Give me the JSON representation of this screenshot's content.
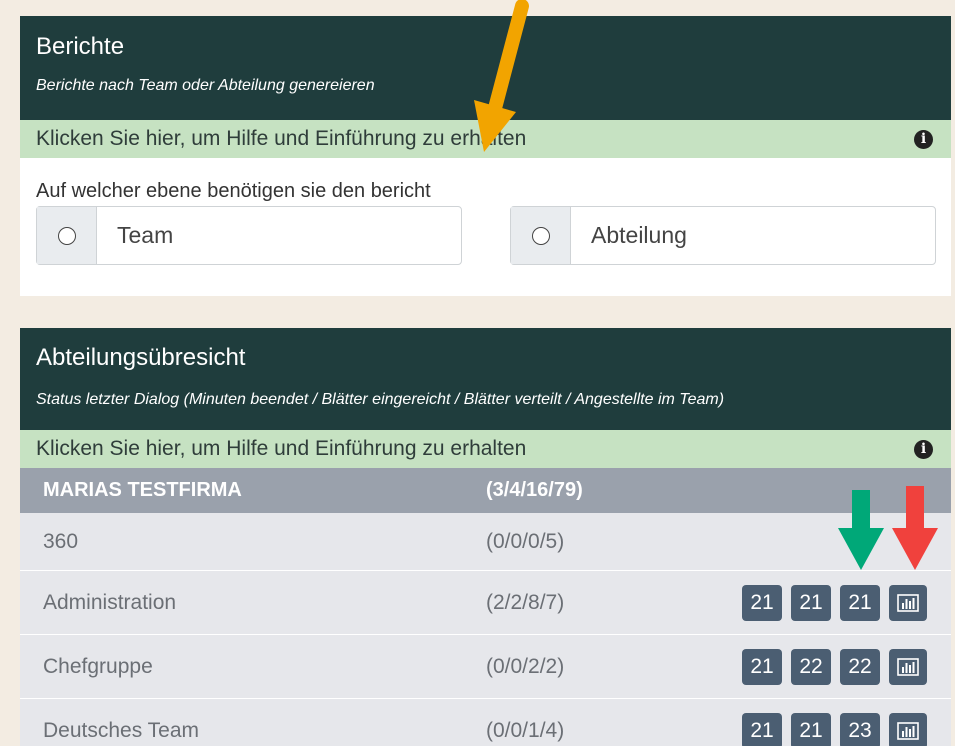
{
  "reports_panel": {
    "title": "Berichte",
    "subtitle": "Berichte nach Team oder Abteilung genereieren",
    "help_text": "Klicken Sie hier, um Hilfe und Einführung zu erhalten",
    "question": "Auf welcher ebene benötigen sie den bericht",
    "options": [
      {
        "label": "Team"
      },
      {
        "label": "Abteilung"
      }
    ]
  },
  "overview_panel": {
    "title": "Abteilungsübresicht",
    "subtitle": "Status letzter Dialog (Minuten beendet / Blätter eingereicht / Blätter verteilt / Angestellte im Team)",
    "help_text": "Klicken Sie hier, um Hilfe und Einführung zu erhalten",
    "company": {
      "name": "MARIAS TESTFIRMA",
      "status": "(3/4/16/79)"
    },
    "departments": [
      {
        "name": "360",
        "status": "(0/0/0/5)",
        "chips": []
      },
      {
        "name": "Administration",
        "status": "(2/2/8/7)",
        "chips": [
          "21",
          "21",
          "21"
        ]
      },
      {
        "name": "Chefgruppe",
        "status": "(0/0/2/2)",
        "chips": [
          "21",
          "22",
          "22"
        ]
      },
      {
        "name": "Deutsches Team",
        "status": "(0/0/1/4)",
        "chips": [
          "21",
          "21",
          "23"
        ]
      }
    ]
  },
  "colors": {
    "header_bg": "#1f3d3d",
    "help_bar_bg": "#c6e2c2",
    "company_row_bg": "#9aa1ac",
    "chip_bg": "#4b5e72",
    "arrow_orange": "#f2a400",
    "arrow_green": "#00a878",
    "arrow_red": "#f0413d"
  },
  "icons": {
    "info": "info-icon",
    "chart": "bar-chart-icon"
  }
}
